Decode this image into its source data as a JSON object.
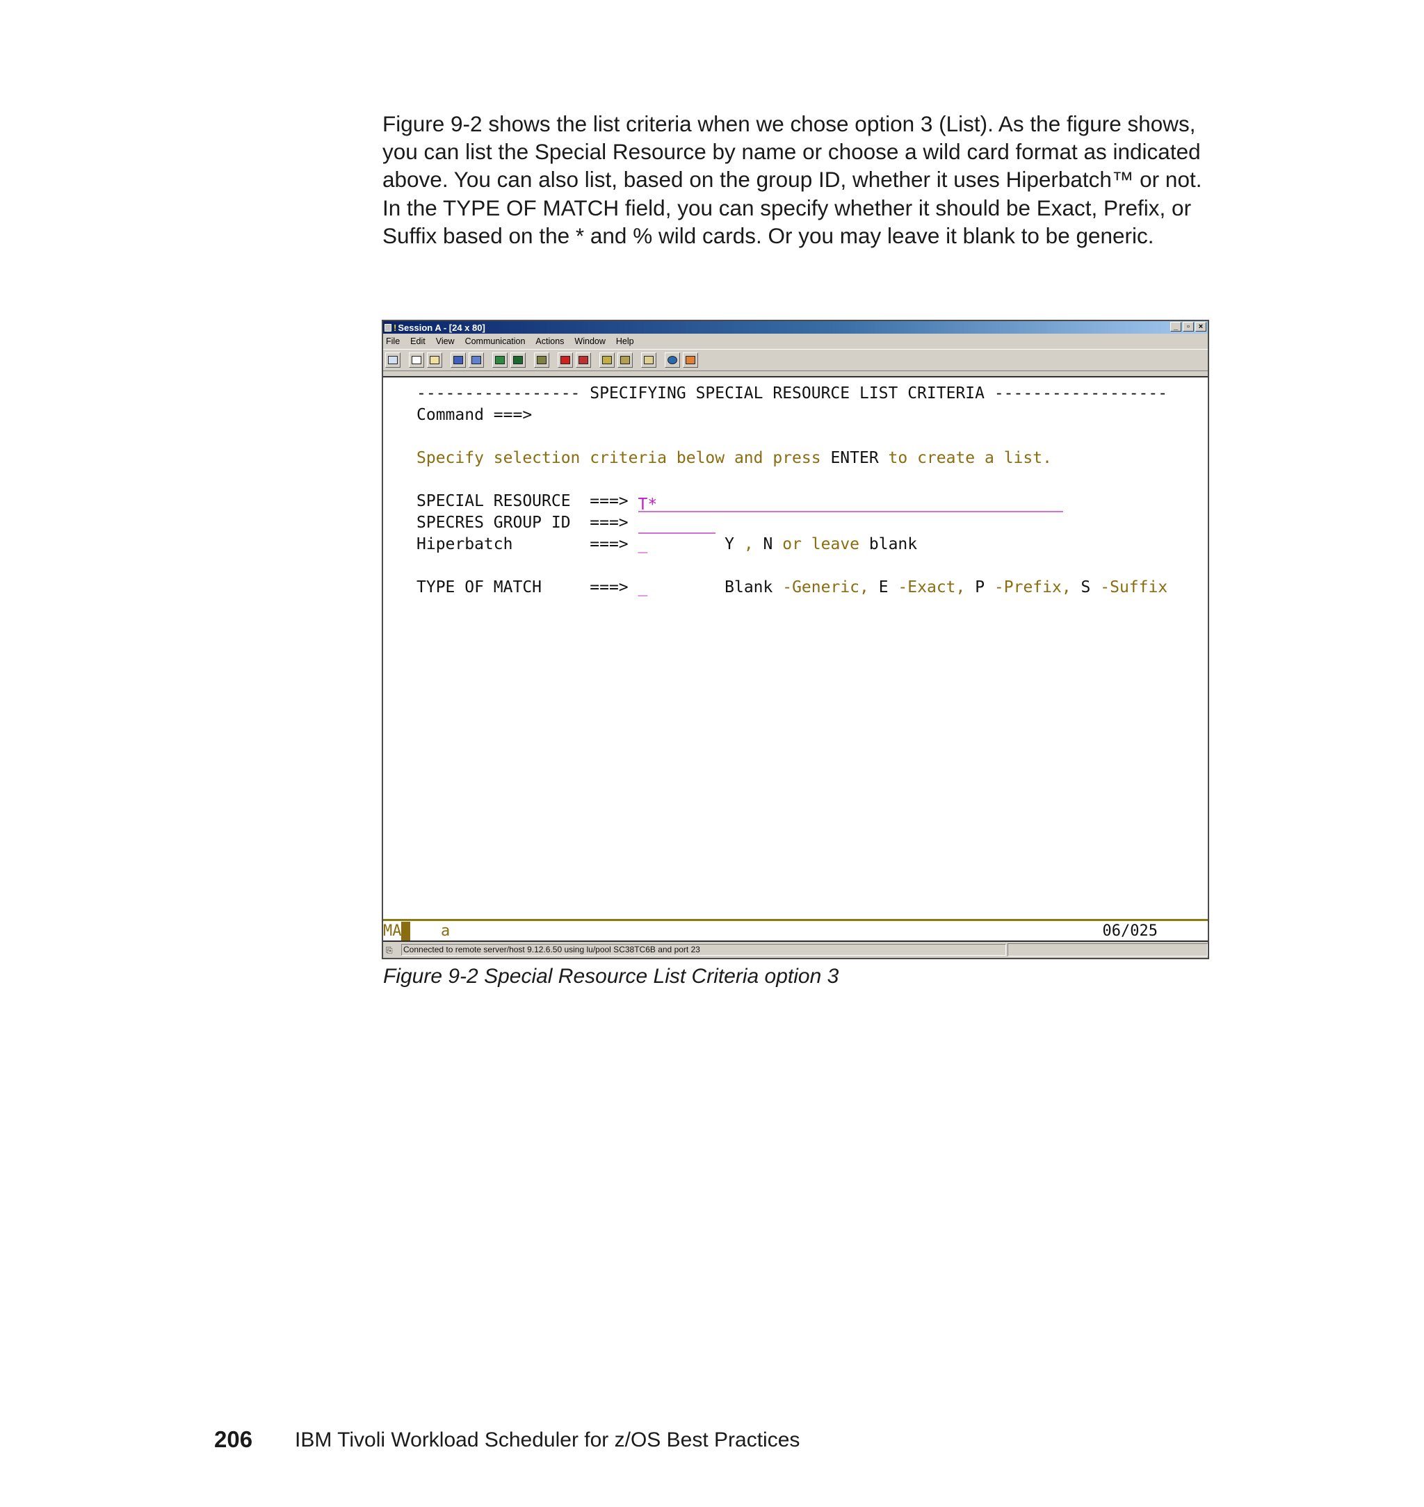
{
  "intro_text": "Figure 9-2 shows the list criteria when we chose option 3 (List). As the figure shows, you can list the Special Resource by name or choose a wild card format as indicated above. You can also list, based on the group ID, whether it uses Hiperbatch™ or not. In the TYPE OF MATCH field, you can specify whether it should be Exact, Prefix, or Suffix based on the * and % wild cards. Or you may leave it blank to be generic.",
  "window": {
    "title": "Session A - [24 x 80]",
    "title_bang": "!",
    "buttons": {
      "minimize": "_",
      "restore": "▫",
      "close": "×"
    },
    "menu": [
      "File",
      "Edit",
      "View",
      "Communication",
      "Actions",
      "Window",
      "Help"
    ]
  },
  "screen": {
    "header": "----------------- SPECIFYING SPECIAL RESOURCE LIST CRITERIA ------------------",
    "command_label": "Command ===>",
    "instruction": {
      "part1": "Specify selection criteria below and press ",
      "enter": "ENTER",
      "part2": " to create a list."
    },
    "fields": {
      "special_resource": {
        "label": "SPECIAL RESOURCE  ===>",
        "value": "T*"
      },
      "group_id": {
        "label": "SPECRES GROUP ID  ===>"
      },
      "hiperbatch": {
        "label": "Hiperbatch        ===>",
        "cursor": "_",
        "hint_y": "Y",
        "hint_sep": " , ",
        "hint_n": "N",
        "hint_or": " or leave ",
        "hint_blank": "blank"
      },
      "type_of_match": {
        "label": "TYPE OF MATCH     ===>",
        "cursor": "_",
        "opt_blank": "Blank",
        "desc_generic": " -Generic, ",
        "opt_e": "E",
        "desc_exact": " -Exact, ",
        "opt_p": "P",
        "desc_prefix": " -Prefix, ",
        "opt_s": "S",
        "desc_suffix": " -Suffix"
      }
    },
    "oia": {
      "mode": "MA",
      "indicator": "a",
      "cursor_pos": "06/025"
    }
  },
  "status_bar": "Connected to remote server/host 9.12.6.50 using lu/pool SC38TC6B and port 23",
  "caption": "Figure 9-2   Special Resource List Criteria option 3",
  "footer": {
    "page_number": "206",
    "title": "IBM Tivoli Workload Scheduler for z/OS Best Practices"
  }
}
